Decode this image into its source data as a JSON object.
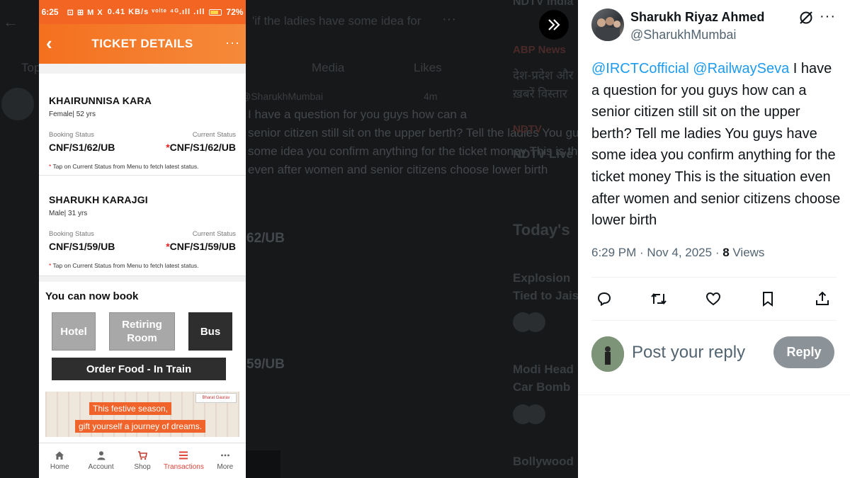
{
  "background": {
    "back_arrow": "←",
    "search_text": "'if the ladies have some idea for",
    "more": "···",
    "tabs": [
      "Top",
      "Media",
      "Likes"
    ],
    "tweet_handle": "@SharukhMumbai",
    "tweet_time": "4m",
    "tweet_lines": [
      "I have a question for you guys how can a",
      "senior citizen still sit on the upper berth? Tell the ladies You guys have",
      "some idea you confirm anything for the ticket money This is the situation",
      "even after women and senior citizens choose lower birth"
    ],
    "ghost_values": [
      "62/UB",
      "59/UB"
    ],
    "right_col": {
      "top": "NDTV India",
      "abp": "ABP News",
      "hindi_1": "देश-प्रदेश और",
      "hindi_2": "ख़बरें विस्तार",
      "ndtv": "NDTV",
      "ndtv_live": "NDTV Live",
      "todays": "Today's",
      "expl_1": "Explosion",
      "expl_2": "Tied to Jais",
      "modi_1": "Modi Head",
      "modi_2": "Car Bomb",
      "bolly": "Bollywood"
    }
  },
  "phone": {
    "status_bar": {
      "time": "6:25",
      "icons": "⊡ ⊞ M X",
      "signal": "0.41 KB/s ᵛᵒˡᵗᵉ ⁴ᴳ.ıll .ıll",
      "battery": "72%"
    },
    "header": {
      "title": "TICKET DETAILS",
      "back": "‹",
      "more": "···"
    },
    "passengers": [
      {
        "name": "KHAIRUNNISA KARA",
        "meta": "Female| 52 yrs",
        "booking_label": "Booking Status",
        "booking_value": "CNF/S1/62/UB",
        "current_label": "Current Status",
        "current_value": "CNF/S1/62/UB",
        "note": "Tap on Current Status from Menu to fetch latest status."
      },
      {
        "name": "SHARUKH KARAJGI",
        "meta": "Male| 31 yrs",
        "booking_label": "Booking Status",
        "booking_value": "CNF/S1/59/UB",
        "current_label": "Current Status",
        "current_value": "CNF/S1/59/UB",
        "note": "Tap on Current Status from Menu to fetch latest status."
      }
    ],
    "book": {
      "title": "You can now book",
      "hotel": "Hotel",
      "retiring_room": "Retiring Room",
      "bus": "Bus",
      "order_food": "Order Food - In Train"
    },
    "banner": {
      "line_1": "This festive season,",
      "line_2": "gift yourself a journey of dreams.",
      "logo": "Bharat Gaurav"
    },
    "nav": [
      {
        "label": "Home",
        "icon": "home-icon",
        "active": false
      },
      {
        "label": "Account",
        "icon": "account-icon",
        "active": false
      },
      {
        "label": "Shop",
        "icon": "shop-icon",
        "active": false
      },
      {
        "label": "Transactions",
        "icon": "transactions-icon",
        "active": true
      },
      {
        "label": "More",
        "icon": "more-icon",
        "active": false
      }
    ]
  },
  "tweet": {
    "author_name": "Sharukh Riyaz Ahmed",
    "author_handle": "@SharukhMumbai",
    "mention_1": "@IRCTCofficial",
    "mention_2": "@RailwaySeva",
    "text": " I have a question for you guys how can a senior citizen still sit on the upper berth? Tell me ladies You guys have some idea you confirm anything for the ticket money This is the situation even after women and senior citizens choose lower birth",
    "timestamp": "6:29 PM · Nov 4, 2025 · ",
    "views_count": "8",
    "views_label": " Views",
    "reply_placeholder": "Post your reply",
    "reply_button": "Reply",
    "more": "···"
  },
  "colors": {
    "irctc_orange": "#f26522",
    "x_blue": "#1d9bf0",
    "reply_btn_disabled": "#8b9298",
    "active_nav": "#e0453a"
  }
}
